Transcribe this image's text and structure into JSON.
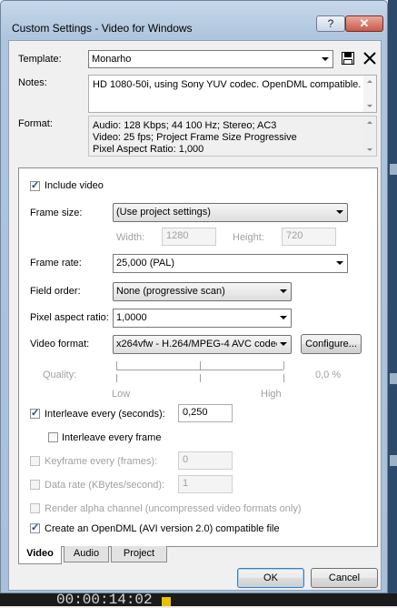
{
  "background": {
    "timecode": "00:00:14:02"
  },
  "window": {
    "title": "Custom Settings - Video for Windows",
    "help_label": "?",
    "close_label": "✕"
  },
  "template": {
    "label": "Template:",
    "value": "Monarho"
  },
  "notes": {
    "label": "Notes:",
    "text": "HD 1080-50i, using Sony YUV codec. OpenDML compatible."
  },
  "format": {
    "label": "Format:",
    "lines": [
      "Audio: 128 Kbps; 44 100 Hz; Stereo; AC3",
      "Video: 25 fps; Project Frame Size Progressive",
      "Pixel Aspect Ratio: 1,000"
    ]
  },
  "video": {
    "include_video_label": "Include video",
    "include_video_checked": true,
    "frame_size_label": "Frame size:",
    "frame_size_value": "(Use project settings)",
    "width_label": "Width:",
    "width_value": "1280",
    "height_label": "Height:",
    "height_value": "720",
    "frame_rate_label": "Frame rate:",
    "frame_rate_value": "25,000 (PAL)",
    "field_order_label": "Field order:",
    "field_order_value": "None (progressive scan)",
    "pixel_aspect_label": "Pixel aspect ratio:",
    "pixel_aspect_value": "1,0000",
    "video_format_label": "Video format:",
    "video_format_value": "x264vfw - H.264/MPEG-4 AVC codec",
    "configure_label": "Configure...",
    "quality_label": "Quality:",
    "quality_value": "0,0 %",
    "quality_low": "Low",
    "quality_high": "High",
    "interleave_label": "Interleave every (seconds):",
    "interleave_checked": true,
    "interleave_value": "0,250",
    "interleave_frame_label": "Interleave every frame",
    "interleave_frame_checked": false,
    "keyframe_label": "Keyframe every (frames):",
    "keyframe_value": "0",
    "data_rate_label": "Data rate (KBytes/second):",
    "data_rate_value": "1",
    "render_alpha_label": "Render alpha channel (uncompressed video formats only)",
    "opendml_label": "Create an OpenDML (AVI version 2.0) compatible file",
    "opendml_checked": true
  },
  "tabs": [
    "Video",
    "Audio",
    "Project"
  ],
  "active_tab": "Video",
  "buttons": {
    "ok": "OK",
    "cancel": "Cancel"
  },
  "colors": {
    "title_bar": "#aec5dd",
    "close_button": "#c95a48",
    "checkbox_mark": "#2b4b82"
  }
}
